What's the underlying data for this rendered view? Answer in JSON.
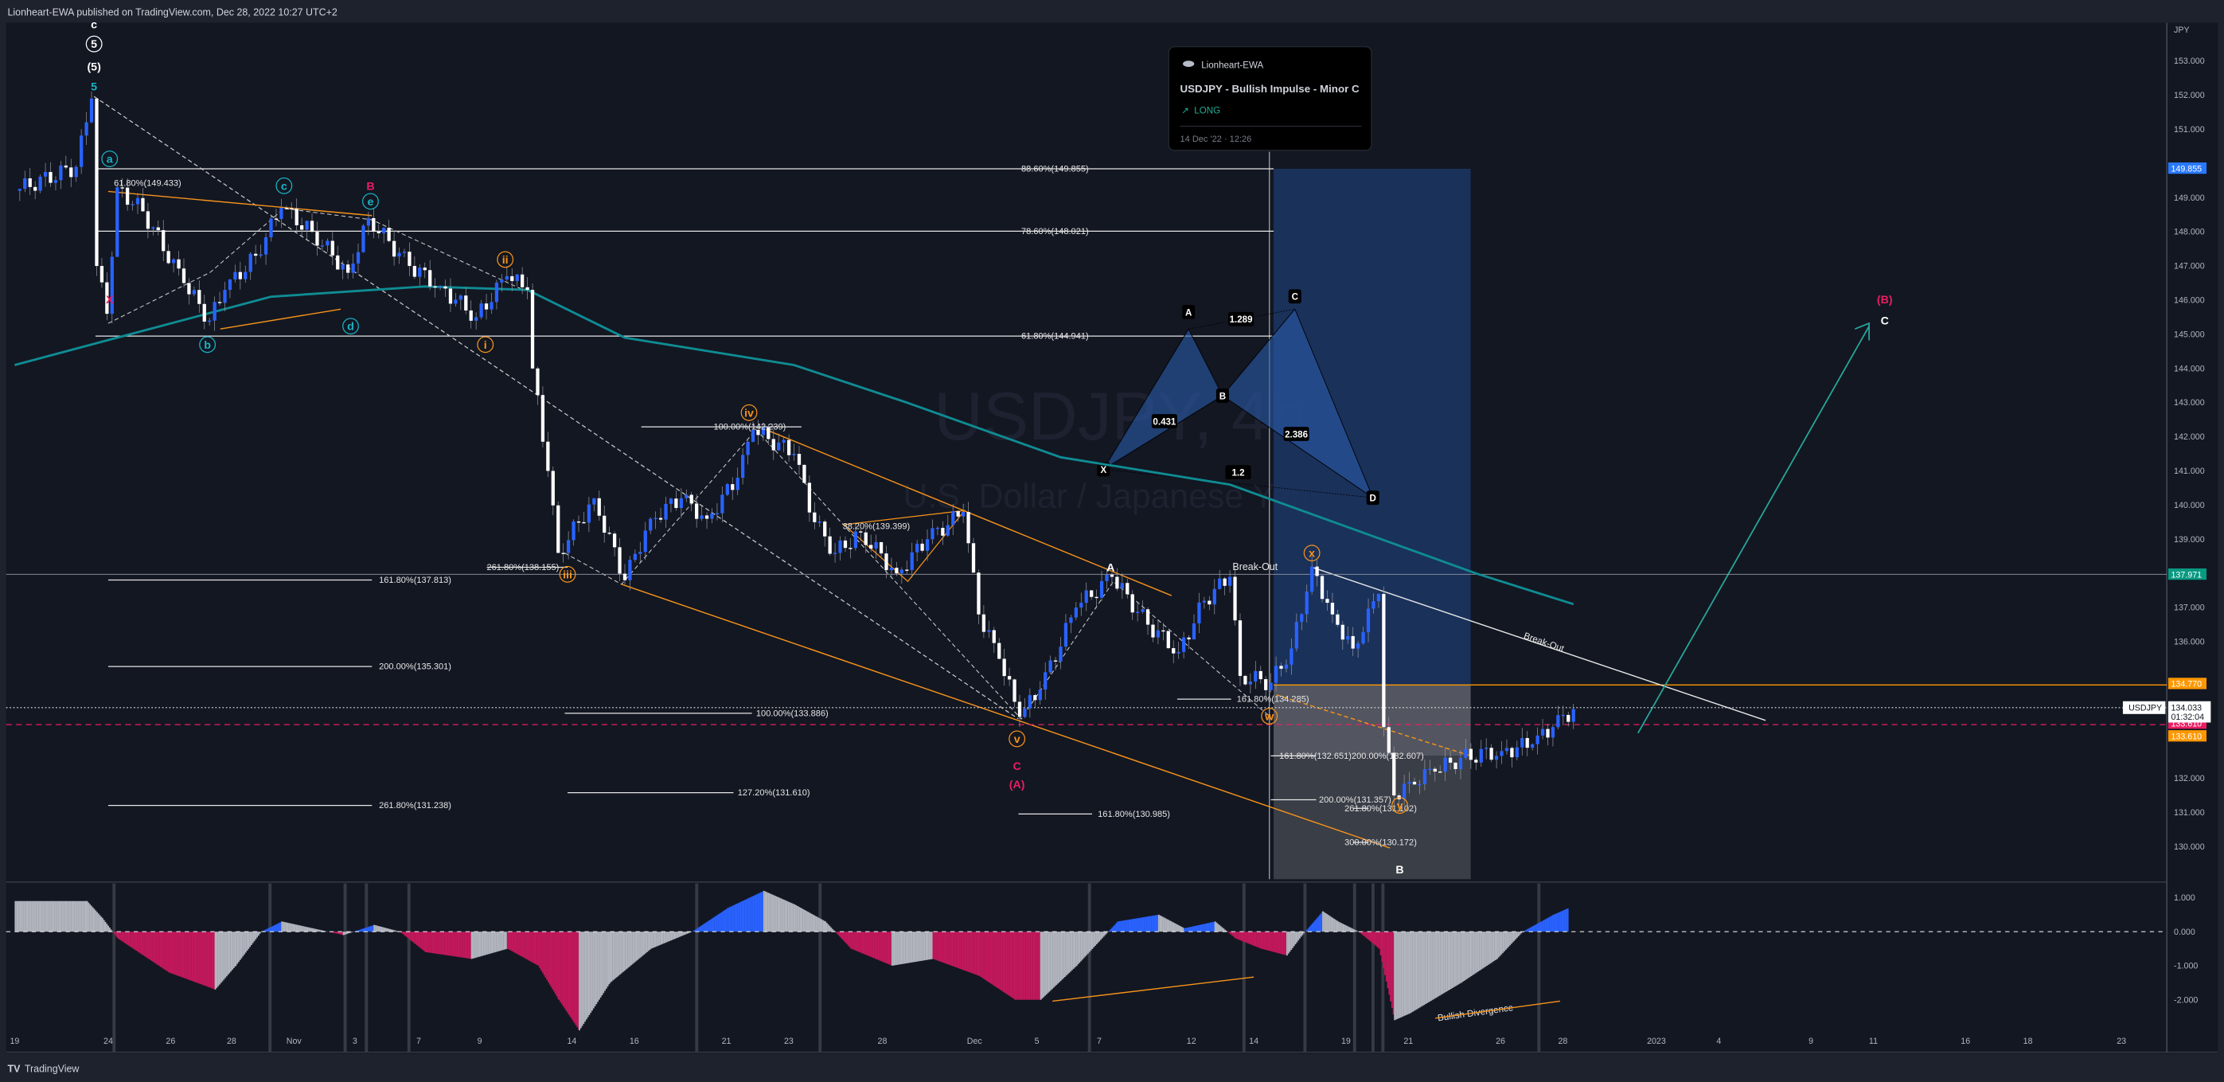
{
  "header": {
    "publish_text": "Lionheart-EWA published on TradingView.com, Dec 28, 2022 10:27 UTC+2"
  },
  "footer": {
    "logo_text": "TradingView"
  },
  "watermark": {
    "symbol": "USDJPY, 4h",
    "description": "U.S. Dollar / Japanese Yen"
  },
  "idea_card": {
    "author": "Lionheart-EWA",
    "title": "USDJPY - Bullish Impulse - Minor C",
    "direction": "LONG",
    "direction_icon": "arrow-up-right-icon",
    "timestamp": "14 Dec '22 · 12:26"
  },
  "colors": {
    "background": "#131722",
    "up_candle": "#2962ff",
    "down_candle": "#ffffff",
    "moving_average": "#0f8c93",
    "wave_orange": "#f7931a",
    "wave_teal": "#18b4c6",
    "wave_red": "#e91e63",
    "long_target": "#1e3a6e",
    "long_stop": "#6b6e78"
  },
  "price_axis": {
    "currency": "JPY",
    "ticks": [
      "153.000",
      "152.000",
      "151.000",
      "149.000",
      "148.000",
      "147.000",
      "146.000",
      "145.000",
      "144.000",
      "143.000",
      "142.000",
      "141.000",
      "140.000",
      "139.000",
      "137.000",
      "136.000",
      "132.000",
      "131.000",
      "130.000"
    ],
    "badges": [
      {
        "value": "149.855",
        "color": "#2979ff"
      },
      {
        "value": "137.971",
        "color": "#089981"
      },
      {
        "value": "134.770",
        "color": "#ff9800"
      },
      {
        "value": "133.610",
        "color": "#e91e63"
      },
      {
        "value": "133.610",
        "color": "#ff9800"
      }
    ],
    "last_price": {
      "symbol": "USDJPY",
      "value": "134.033",
      "countdown": "01:32:04"
    }
  },
  "oscillator_axis": {
    "ticks": [
      "1.000",
      "0.000",
      "-1.000",
      "-2.000"
    ]
  },
  "time_axis": {
    "ticks": [
      "19",
      "24",
      "26",
      "28",
      "Nov",
      "3",
      "7",
      "9",
      "14",
      "16",
      "21",
      "23",
      "28",
      "Dec",
      "5",
      "7",
      "12",
      "14",
      "19",
      "21",
      "26",
      "28",
      "2023",
      "4",
      "9",
      "11",
      "16",
      "18",
      "23"
    ]
  },
  "annotations": {
    "fibs": [
      "88.60%(149.855)",
      "78.60%(148.021)",
      "61.80%(144.941)",
      "61.80%(149.433)",
      "100.00%(142.239)",
      "261.80%(138.155)",
      "161.80%(137.813)",
      "200.00%(135.301)",
      "100.00%(133.886)",
      "127.20%(131.610)",
      "261.80%(131.238)",
      "161.80%(130.985)",
      "38.20%(139.399)",
      "161.80%(134.285)",
      "161.80%(132.651)",
      "200.00%(132.607)",
      "200.00%(131.357)",
      "261.80%(131.102)",
      "300.00%(130.172)"
    ],
    "texts": [
      "Break-Out",
      "Break-Out",
      "Bullish Divergence"
    ],
    "waves": [
      "c",
      "5",
      "(5)",
      "5",
      "a",
      "c",
      "B",
      "e",
      "b",
      "d",
      "X",
      "ii",
      "i",
      "iii",
      "iv",
      "v",
      "C",
      "(A)",
      "A",
      "x",
      "w",
      "y",
      "B",
      "(B)",
      "C"
    ],
    "harmonic": {
      "points": [
        "X",
        "A",
        "B",
        "C",
        "D"
      ],
      "ratios": [
        "0.431",
        "1.289",
        "2.386",
        "1.2"
      ]
    }
  },
  "chart_data": {
    "type": "candlestick",
    "symbol": "USDJPY",
    "interval": "4h",
    "ylim": [
      129.5,
      153.5
    ],
    "grid": false,
    "price_path": [
      [
        "2022-10-19T00:00",
        149.2
      ],
      [
        "2022-10-21T00:00",
        149.9
      ],
      [
        "2022-10-21T12:00",
        151.9
      ],
      [
        "2022-10-21T16:00",
        147.0
      ],
      [
        "2022-10-24T00:00",
        145.6
      ],
      [
        "2022-10-24T08:00",
        149.3
      ],
      [
        "2022-10-25T04:00",
        148.6
      ],
      [
        "2022-10-26T12:00",
        146.5
      ],
      [
        "2022-10-27T08:00",
        145.4
      ],
      [
        "2022-10-27T20:00",
        146.3
      ],
      [
        "2022-10-28T20:00",
        147.3
      ],
      [
        "2022-10-31T16:00",
        148.7
      ],
      [
        "2022-11-01T16:00",
        148.0
      ],
      [
        "2022-11-02T20:00",
        146.8
      ],
      [
        "2022-11-03T12:00",
        148.4
      ],
      [
        "2022-11-04T20:00",
        147.0
      ],
      [
        "2022-11-07T20:00",
        146.4
      ],
      [
        "2022-11-09T00:00",
        145.5
      ],
      [
        "2022-11-10T00:00",
        146.7
      ],
      [
        "2022-11-10T16:00",
        146.3
      ],
      [
        "2022-11-10T20:00",
        144.0
      ],
      [
        "2022-11-11T08:00",
        141.0
      ],
      [
        "2022-11-11T16:00",
        138.6
      ],
      [
        "2022-11-14T08:00",
        139.5
      ],
      [
        "2022-11-14T20:00",
        140.2
      ],
      [
        "2022-11-15T20:00",
        137.8
      ],
      [
        "2022-11-16T16:00",
        139.6
      ],
      [
        "2022-11-17T16:00",
        140.2
      ],
      [
        "2022-11-18T12:00",
        139.6
      ],
      [
        "2022-11-21T12:00",
        140.8
      ],
      [
        "2022-11-22T00:00",
        142.2
      ],
      [
        "2022-11-23T08:00",
        141.5
      ],
      [
        "2022-11-24T00:00",
        139.5
      ],
      [
        "2022-11-24T16:00",
        138.6
      ],
      [
        "2022-11-25T12:00",
        139.2
      ],
      [
        "2022-11-28T16:00",
        138.0
      ],
      [
        "2022-11-29T16:00",
        139.0
      ],
      [
        "2022-11-30T20:00",
        139.8
      ],
      [
        "2022-12-01T08:00",
        136.8
      ],
      [
        "2022-12-02T00:00",
        135.5
      ],
      [
        "2022-12-02T16:00",
        133.8
      ],
      [
        "2022-12-05T08:00",
        134.6
      ],
      [
        "2022-12-06T12:00",
        137.0
      ],
      [
        "2022-12-07T16:00",
        137.9
      ],
      [
        "2022-12-08T20:00",
        136.5
      ],
      [
        "2022-12-09T20:00",
        135.7
      ],
      [
        "2022-12-12T16:00",
        137.2
      ],
      [
        "2022-12-13T12:00",
        137.9
      ],
      [
        "2022-12-13T20:00",
        135.0
      ],
      [
        "2022-12-14T20:00",
        134.8
      ],
      [
        "2022-12-15T12:00",
        135.8
      ],
      [
        "2022-12-16T04:00",
        138.2
      ],
      [
        "2022-12-16T20:00",
        136.8
      ],
      [
        "2022-12-19T12:00",
        135.8
      ],
      [
        "2022-12-20T08:00",
        137.4
      ],
      [
        "2022-12-20T12:00",
        133.5
      ],
      [
        "2022-12-20T20:00",
        131.5
      ],
      [
        "2022-12-21T08:00",
        131.9
      ],
      [
        "2022-12-22T04:00",
        132.2
      ],
      [
        "2022-12-23T00:00",
        132.6
      ],
      [
        "2022-12-26T08:00",
        132.8
      ],
      [
        "2022-12-27T08:00",
        133.0
      ],
      [
        "2022-12-28T00:00",
        133.5
      ],
      [
        "2022-12-28T16:00",
        134.03
      ]
    ],
    "moving_average": [
      [
        "2022-10-19T00:00",
        144.1
      ],
      [
        "2022-10-31T08:00",
        146.1
      ],
      [
        "2022-11-07T08:00",
        146.4
      ],
      [
        "2022-11-10T16:00",
        146.3
      ],
      [
        "2022-11-15T20:00",
        144.9
      ],
      [
        "2022-11-23T08:00",
        144.1
      ],
      [
        "2022-11-29T00:00",
        143.0
      ],
      [
        "2022-12-06T00:00",
        141.4
      ],
      [
        "2022-12-13T12:00",
        140.6
      ],
      [
        "2022-12-19T12:00",
        139.3
      ],
      [
        "2022-12-23T12:00",
        138.0
      ],
      [
        "2022-12-28T16:00",
        137.1
      ]
    ],
    "oscillator": [
      [
        "2022-10-19T00:00",
        0.9
      ],
      [
        "2022-10-21T08:00",
        0.9
      ],
      [
        "2022-10-21T20:00",
        0.4
      ],
      [
        "2022-10-24T08:00",
        -0.2
      ],
      [
        "2022-10-26T00:00",
        -1.2
      ],
      [
        "2022-10-27T12:00",
        -1.7
      ],
      [
        "2022-10-28T04:00",
        -1.0
      ],
      [
        "2022-10-31T00:00",
        0
      ],
      [
        "2022-10-31T16:00",
        0.3
      ],
      [
        "2022-11-01T16:00",
        0.1
      ],
      [
        "2022-11-02T16:00",
        -0.1
      ],
      [
        "2022-11-03T16:00",
        0.2
      ],
      [
        "2022-11-04T12:00",
        0
      ],
      [
        "2022-11-07T08:00",
        -0.6
      ],
      [
        "2022-11-08T20:00",
        -0.8
      ],
      [
        "2022-11-10T00:00",
        -0.5
      ],
      [
        "2022-11-11T00:00",
        -1.0
      ],
      [
        "2022-11-11T16:00",
        -2.0
      ],
      [
        "2022-11-14T08:00",
        -2.9
      ],
      [
        "2022-11-15T08:00",
        -1.5
      ],
      [
        "2022-11-16T16:00",
        -0.5
      ],
      [
        "2022-11-18T00:00",
        0
      ],
      [
        "2022-11-21T04:00",
        0.7
      ],
      [
        "2022-11-22T08:00",
        1.2
      ],
      [
        "2022-11-23T08:00",
        0.8
      ],
      [
        "2022-11-24T08:00",
        0.3
      ],
      [
        "2022-11-25T04:00",
        -0.5
      ],
      [
        "2022-11-28T12:00",
        -1.0
      ],
      [
        "2022-11-29T20:00",
        -0.8
      ],
      [
        "2022-12-01T08:00",
        -1.3
      ],
      [
        "2022-12-02T12:00",
        -2.0
      ],
      [
        "2022-12-05T08:00",
        -2.0
      ],
      [
        "2022-12-06T12:00",
        -1.0
      ],
      [
        "2022-12-07T20:00",
        0.3
      ],
      [
        "2022-12-09T04:00",
        0.5
      ],
      [
        "2022-12-12T00:00",
        0.1
      ],
      [
        "2022-12-13T00:00",
        0.3
      ],
      [
        "2022-12-13T16:00",
        -0.2
      ],
      [
        "2022-12-14T12:00",
        -0.5
      ],
      [
        "2022-12-15T08:00",
        -0.7
      ],
      [
        "2022-12-15T20:00",
        -0.1
      ],
      [
        "2022-12-16T12:00",
        0.6
      ],
      [
        "2022-12-19T00:00",
        0.3
      ],
      [
        "2022-12-19T16:00",
        0
      ],
      [
        "2022-12-20T08:00",
        -0.5
      ],
      [
        "2022-12-20T20:00",
        -2.6
      ],
      [
        "2022-12-21T08:00",
        -2.4
      ],
      [
        "2022-12-23T00:00",
        -1.5
      ],
      [
        "2022-12-26T04:00",
        -0.8
      ],
      [
        "2022-12-27T00:00",
        0
      ],
      [
        "2022-12-28T00:00",
        0.5
      ],
      [
        "2022-12-28T12:00",
        0.7
      ]
    ],
    "oscillator_ylim": [
      -3,
      1.2
    ]
  }
}
